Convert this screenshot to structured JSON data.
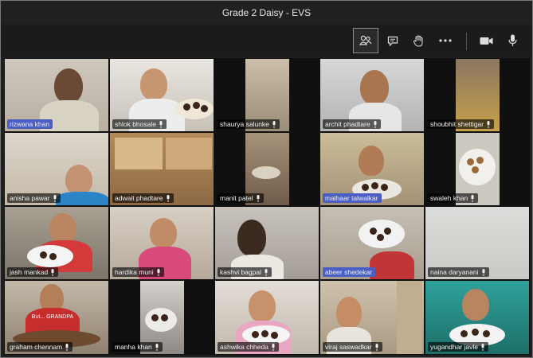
{
  "window": {
    "title": "Grade 2 Daisy - EVS"
  },
  "toolbar": {
    "buttons": [
      {
        "name": "participants-button",
        "icon": "participants-icon",
        "active": true
      },
      {
        "name": "chat-button",
        "icon": "chat-icon",
        "active": false
      },
      {
        "name": "raise-hand-button",
        "icon": "raise-hand-icon",
        "active": false
      },
      {
        "name": "more-options-button",
        "icon": "more-icon",
        "active": false
      },
      {
        "name": "camera-button",
        "icon": "camera-icon",
        "active": false
      },
      {
        "name": "microphone-button",
        "icon": "microphone-icon",
        "active": false
      }
    ]
  },
  "participants": [
    {
      "name": "rizwana khan",
      "highlight": true
    },
    {
      "name": "shlok bhosale",
      "highlight": false
    },
    {
      "name": "shaurya salunke",
      "highlight": false
    },
    {
      "name": "archit phadtare",
      "highlight": false
    },
    {
      "name": "shoubhit shettigar",
      "highlight": false
    },
    {
      "name": "anisha pawar",
      "highlight": false
    },
    {
      "name": "adwait phadtare",
      "highlight": false
    },
    {
      "name": "manit patel",
      "highlight": false
    },
    {
      "name": "malhaar talwalkar",
      "highlight": true
    },
    {
      "name": "swaleh khan",
      "highlight": false
    },
    {
      "name": "jash mankad",
      "highlight": false
    },
    {
      "name": "hardika muni",
      "highlight": false
    },
    {
      "name": "kashvi bagpal",
      "highlight": false
    },
    {
      "name": "abeer shedekar",
      "highlight": true
    },
    {
      "name": "naina daryanani",
      "highlight": false
    },
    {
      "name": "graham chennam",
      "highlight": false
    },
    {
      "name": "manha khan",
      "highlight": false
    },
    {
      "name": "ashwika chheda",
      "highlight": false
    },
    {
      "name": "viraj saswadkar",
      "highlight": false
    },
    {
      "name": "yugandhar javle",
      "highlight": false
    }
  ],
  "shirt_text": "But... GRANDPA"
}
